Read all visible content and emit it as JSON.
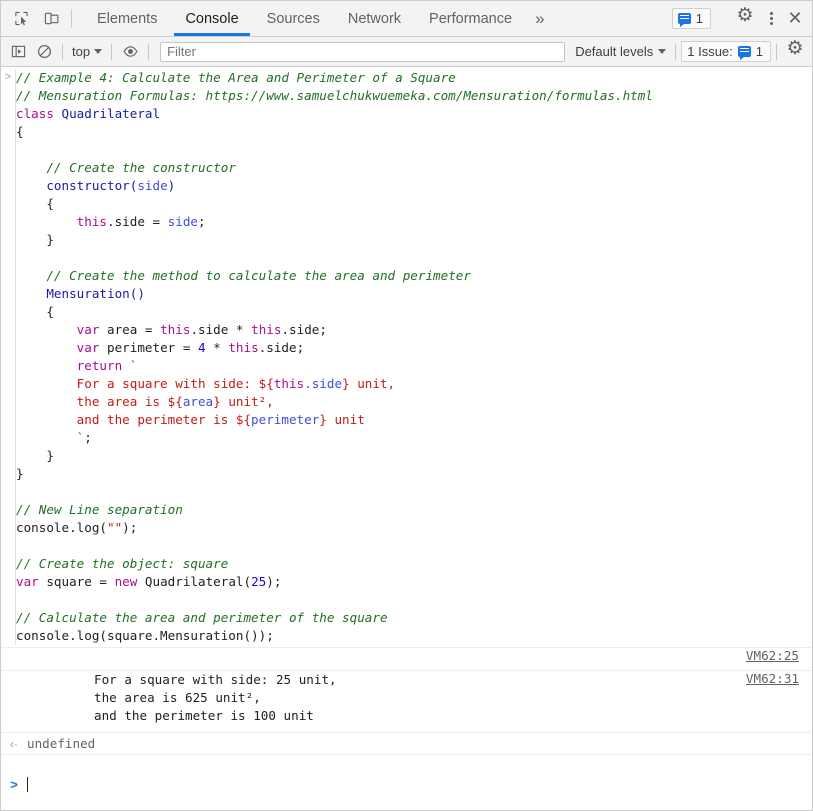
{
  "window": {
    "left_icons": [
      {
        "name": "inspect-element-icon",
        "label": "Inspect element"
      },
      {
        "name": "device-toolbar-icon",
        "label": "Toggle device toolbar"
      }
    ],
    "tabs": [
      {
        "label": "Elements",
        "active": false
      },
      {
        "label": "Console",
        "active": true
      },
      {
        "label": "Sources",
        "active": false
      },
      {
        "label": "Network",
        "active": false
      },
      {
        "label": "Performance",
        "active": false
      }
    ],
    "more_tabs_label": "»",
    "issue_badge_count": "1",
    "settings_label": "Settings",
    "menu_label": "Customize and control DevTools",
    "close_label": "✕"
  },
  "toolbar": {
    "execute_label": "Console sidebar",
    "clear_label": "Clear console",
    "context_value": "top",
    "eye_label": "Live expression",
    "filter_placeholder": "Filter",
    "filter_value": "",
    "levels_label": "Default levels",
    "issues_label": "1 Issue:",
    "issues_count": "1",
    "settings_label": "Console settings"
  },
  "console": {
    "input_gutter": ">",
    "code_lines": [
      [
        {
          "t": "// Example 4: Calculate the Area and Perimeter of a Square",
          "c": "cmt"
        }
      ],
      [
        {
          "t": "// Mensuration Formulas: https://www.samuelchukwuemeka.com/Mensuration/formulas.html",
          "c": "cmt"
        }
      ],
      [
        {
          "t": "class ",
          "c": "kw"
        },
        {
          "t": "Quadrilateral",
          "c": "name"
        }
      ],
      [
        {
          "t": "{",
          "c": "plain"
        }
      ],
      [
        {
          "t": "",
          "c": "plain"
        }
      ],
      [
        {
          "t": "    ",
          "c": "plain"
        },
        {
          "t": "// Create the constructor",
          "c": "cmt"
        }
      ],
      [
        {
          "t": "    constructor(",
          "c": "name"
        },
        {
          "t": "side",
          "c": "par"
        },
        {
          "t": ")",
          "c": "name"
        }
      ],
      [
        {
          "t": "    {",
          "c": "plain"
        }
      ],
      [
        {
          "t": "        ",
          "c": "plain"
        },
        {
          "t": "this",
          "c": "kw"
        },
        {
          "t": ".side = ",
          "c": "plain"
        },
        {
          "t": "side",
          "c": "par"
        },
        {
          "t": ";",
          "c": "plain"
        }
      ],
      [
        {
          "t": "    }",
          "c": "plain"
        }
      ],
      [
        {
          "t": "",
          "c": "plain"
        }
      ],
      [
        {
          "t": "    ",
          "c": "plain"
        },
        {
          "t": "// Create the method to calculate the area and perimeter",
          "c": "cmt"
        }
      ],
      [
        {
          "t": "    Mensuration()",
          "c": "name"
        }
      ],
      [
        {
          "t": "    {",
          "c": "plain"
        }
      ],
      [
        {
          "t": "        ",
          "c": "plain"
        },
        {
          "t": "var",
          "c": "kw"
        },
        {
          "t": " area = ",
          "c": "plain"
        },
        {
          "t": "this",
          "c": "kw"
        },
        {
          "t": ".side * ",
          "c": "plain"
        },
        {
          "t": "this",
          "c": "kw"
        },
        {
          "t": ".side;",
          "c": "plain"
        }
      ],
      [
        {
          "t": "        ",
          "c": "plain"
        },
        {
          "t": "var",
          "c": "kw"
        },
        {
          "t": " perimeter = ",
          "c": "plain"
        },
        {
          "t": "4",
          "c": "num"
        },
        {
          "t": " * ",
          "c": "plain"
        },
        {
          "t": "this",
          "c": "kw"
        },
        {
          "t": ".side;",
          "c": "plain"
        }
      ],
      [
        {
          "t": "        ",
          "c": "plain"
        },
        {
          "t": "return",
          "c": "kw"
        },
        {
          "t": " ",
          "c": "plain"
        },
        {
          "t": "`",
          "c": "str"
        }
      ],
      [
        {
          "t": "        For a square with side: ${",
          "c": "str"
        },
        {
          "t": "this",
          "c": "kw"
        },
        {
          "t": ".side",
          "c": "par"
        },
        {
          "t": "} unit,",
          "c": "str"
        }
      ],
      [
        {
          "t": "        the area is ${",
          "c": "str"
        },
        {
          "t": "area",
          "c": "par"
        },
        {
          "t": "} unit²,",
          "c": "str"
        }
      ],
      [
        {
          "t": "        and the perimeter is ${",
          "c": "str"
        },
        {
          "t": "perimeter",
          "c": "par"
        },
        {
          "t": "} unit",
          "c": "str"
        }
      ],
      [
        {
          "t": "        `",
          "c": "str"
        },
        {
          "t": ";",
          "c": "plain"
        }
      ],
      [
        {
          "t": "    }",
          "c": "plain"
        }
      ],
      [
        {
          "t": "}",
          "c": "plain"
        }
      ],
      [
        {
          "t": "",
          "c": "plain"
        }
      ],
      [
        {
          "t": "// New Line separation",
          "c": "cmt"
        }
      ],
      [
        {
          "t": "console.log(",
          "c": "plain"
        },
        {
          "t": "\"\"",
          "c": "str"
        },
        {
          "t": ");",
          "c": "plain"
        }
      ],
      [
        {
          "t": "",
          "c": "plain"
        }
      ],
      [
        {
          "t": "// Create the object: square",
          "c": "cmt"
        }
      ],
      [
        {
          "t": "var",
          "c": "kw"
        },
        {
          "t": " square = ",
          "c": "plain"
        },
        {
          "t": "new",
          "c": "kw"
        },
        {
          "t": " Quadrilateral(",
          "c": "plain"
        },
        {
          "t": "25",
          "c": "num"
        },
        {
          "t": ");",
          "c": "plain"
        }
      ],
      [
        {
          "t": "",
          "c": "plain"
        }
      ],
      [
        {
          "t": "// Calculate the area and perimeter of the square",
          "c": "cmt"
        }
      ],
      [
        {
          "t": "console.log(square.Mensuration());",
          "c": "plain"
        }
      ]
    ],
    "outputs": [
      {
        "link": "VM62:25",
        "text": ""
      },
      {
        "link": "VM62:31",
        "text": "For a square with side: 25 unit,\nthe area is 625 unit²,\nand the perimeter is 100 unit"
      }
    ],
    "result_gutter": "‹·",
    "result_value": "undefined",
    "prompt_gutter": ">",
    "prompt_value": ""
  },
  "colors": {
    "accent": "#1a73e8",
    "comment": "#236e25",
    "keyword": "#aa0d91",
    "string": "#c41a16",
    "number": "#1c00cf",
    "identifier": "#1a1aa6",
    "chrome_bg": "#f3f3f3"
  }
}
